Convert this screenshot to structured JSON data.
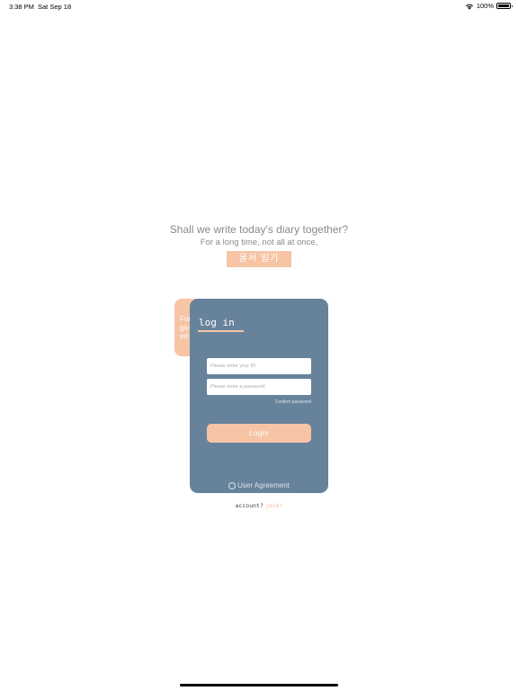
{
  "status_bar": {
    "time": "3:38 PM",
    "date": "Sat Sep 18",
    "battery": "100%",
    "wifi_icon": "wifi-icon",
    "battery_icon": "battery-icon"
  },
  "intro": {
    "headline": "Shall we write today's diary together?",
    "subline": "For a long time, not all at once,",
    "brand": "울서 일기"
  },
  "back_card": {
    "text": "For\ngiv\ned"
  },
  "login": {
    "title": "log in",
    "id_placeholder": "Please enter your ID",
    "password_placeholder": "Please enter a password",
    "confirm_password": "Confirm password",
    "login_button": "Login",
    "user_agreement": "User Agreement"
  },
  "footer": {
    "account_prompt": "account?",
    "join_label": "join!"
  },
  "colors": {
    "card": "#67829b",
    "accent": "#f7c4a6",
    "text_muted": "#8a8a8a"
  }
}
